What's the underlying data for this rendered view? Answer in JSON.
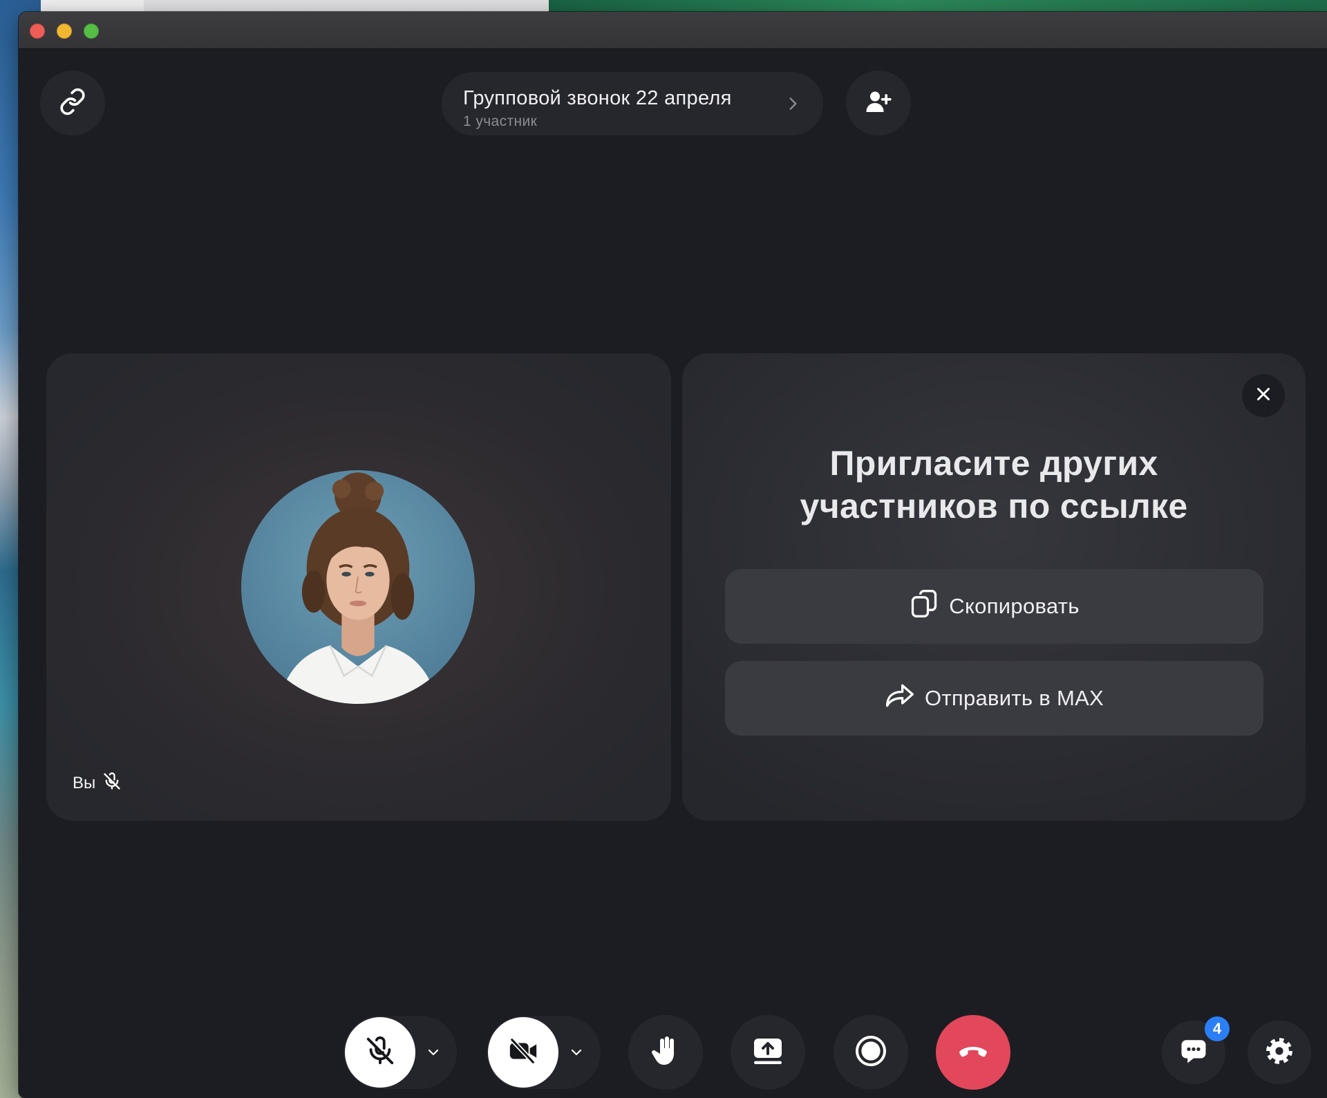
{
  "window": {
    "traffic_lights": {
      "close": "#ee5e56",
      "minimize": "#f2b731",
      "zoom": "#56bd45"
    }
  },
  "header": {
    "link_icon": "link-icon",
    "title": "Групповой звонок 22 апреля",
    "subtitle": "1 участник",
    "chevron_icon": "chevron-right-icon",
    "add_participant_icon": "add-user-icon"
  },
  "self_tile": {
    "label": "Вы",
    "mic_icon": "mic-off-icon",
    "avatar": "avatar-photo"
  },
  "invite_panel": {
    "close_icon": "close-icon",
    "heading_line1": "Пригласите других",
    "heading_line2": "участников по ссылке",
    "copy_button": {
      "label": "Скопировать",
      "icon": "copy-icon"
    },
    "send_button": {
      "label": "Отправить в MAX",
      "icon": "share-arrow-icon"
    }
  },
  "toolbar": {
    "microphone": {
      "icon": "mic-off-icon",
      "menu_icon": "chevron-down-icon"
    },
    "camera": {
      "icon": "video-off-icon",
      "menu_icon": "chevron-down-icon"
    },
    "raise_hand": {
      "icon": "hand-icon"
    },
    "screen_share": {
      "icon": "screen-share-icon"
    },
    "record": {
      "icon": "record-icon"
    },
    "hang_up": {
      "icon": "hangup-icon"
    },
    "chat": {
      "icon": "chat-icon",
      "badge": "4"
    },
    "settings": {
      "icon": "gear-icon"
    }
  },
  "colors": {
    "stage_background": "#1c1d22",
    "control_surface": "#26272c",
    "tile_button": "#3a3b41",
    "hangup_red": "#e2475b",
    "badge_blue": "#2b7ff6",
    "text_primary": "#f0f0f3",
    "text_secondary": "#8b8c92"
  }
}
